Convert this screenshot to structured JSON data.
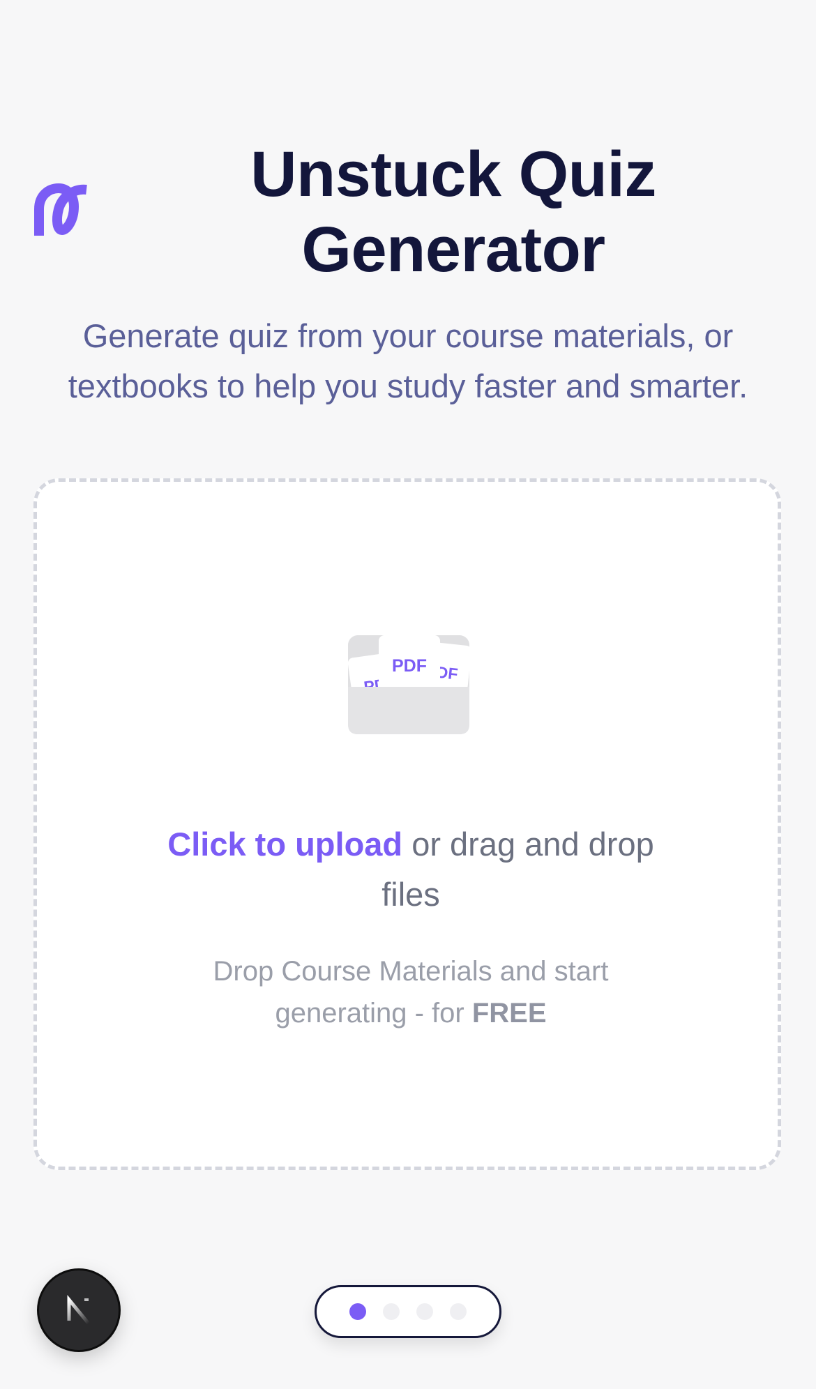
{
  "header": {
    "logo_icon": "unstuck-logo-icon",
    "title": "Unstuck Quiz Generator",
    "subtitle": "Generate quiz from your course materials, or textbooks to help you study faster and smarter."
  },
  "upload": {
    "icon": "pdf-folder-icon",
    "pdf_label_back_left": "PDF",
    "pdf_label_front": "PDF",
    "pdf_label_back_right": "PDF",
    "link_label": "Click to upload",
    "rest_label": " or drag and drop files",
    "hint_prefix": "Drop Course Materials and start generating - for ",
    "hint_emphasis": "FREE"
  },
  "footer": {
    "badge_icon": "nextjs-icon",
    "pager": {
      "total": 4,
      "active_index": 0
    }
  },
  "colors": {
    "accent": "#7b5cf5",
    "title": "#13163b",
    "subtitle": "#5a5f98",
    "background": "#f7f7f8"
  }
}
